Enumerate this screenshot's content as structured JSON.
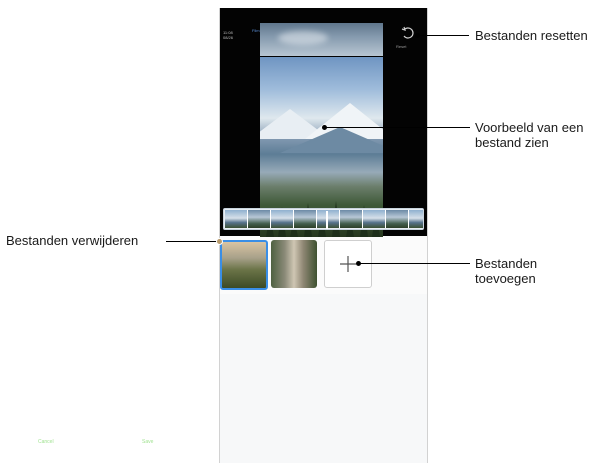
{
  "phone": {
    "status_time": "11:08",
    "status_date": "08/26",
    "status_blue": "Film",
    "reset_label": "Reset",
    "cancel_label": "Cancel",
    "save_label": "Save"
  },
  "callouts": {
    "reset": "Bestanden resetten",
    "preview_line1": "Voorbeeld van een",
    "preview_line2": "bestand zien",
    "delete": "Bestanden verwijderen",
    "add_line1": "Bestanden",
    "add_line2": "toevoegen"
  },
  "colors": {
    "accent_blue": "#3a8ee6",
    "button_green": "#9fe28f",
    "callout_line": "#000000"
  },
  "icons": {
    "reset": "reset-rotate-icon",
    "add": "plus-icon",
    "delete": "remove-file-dot"
  }
}
